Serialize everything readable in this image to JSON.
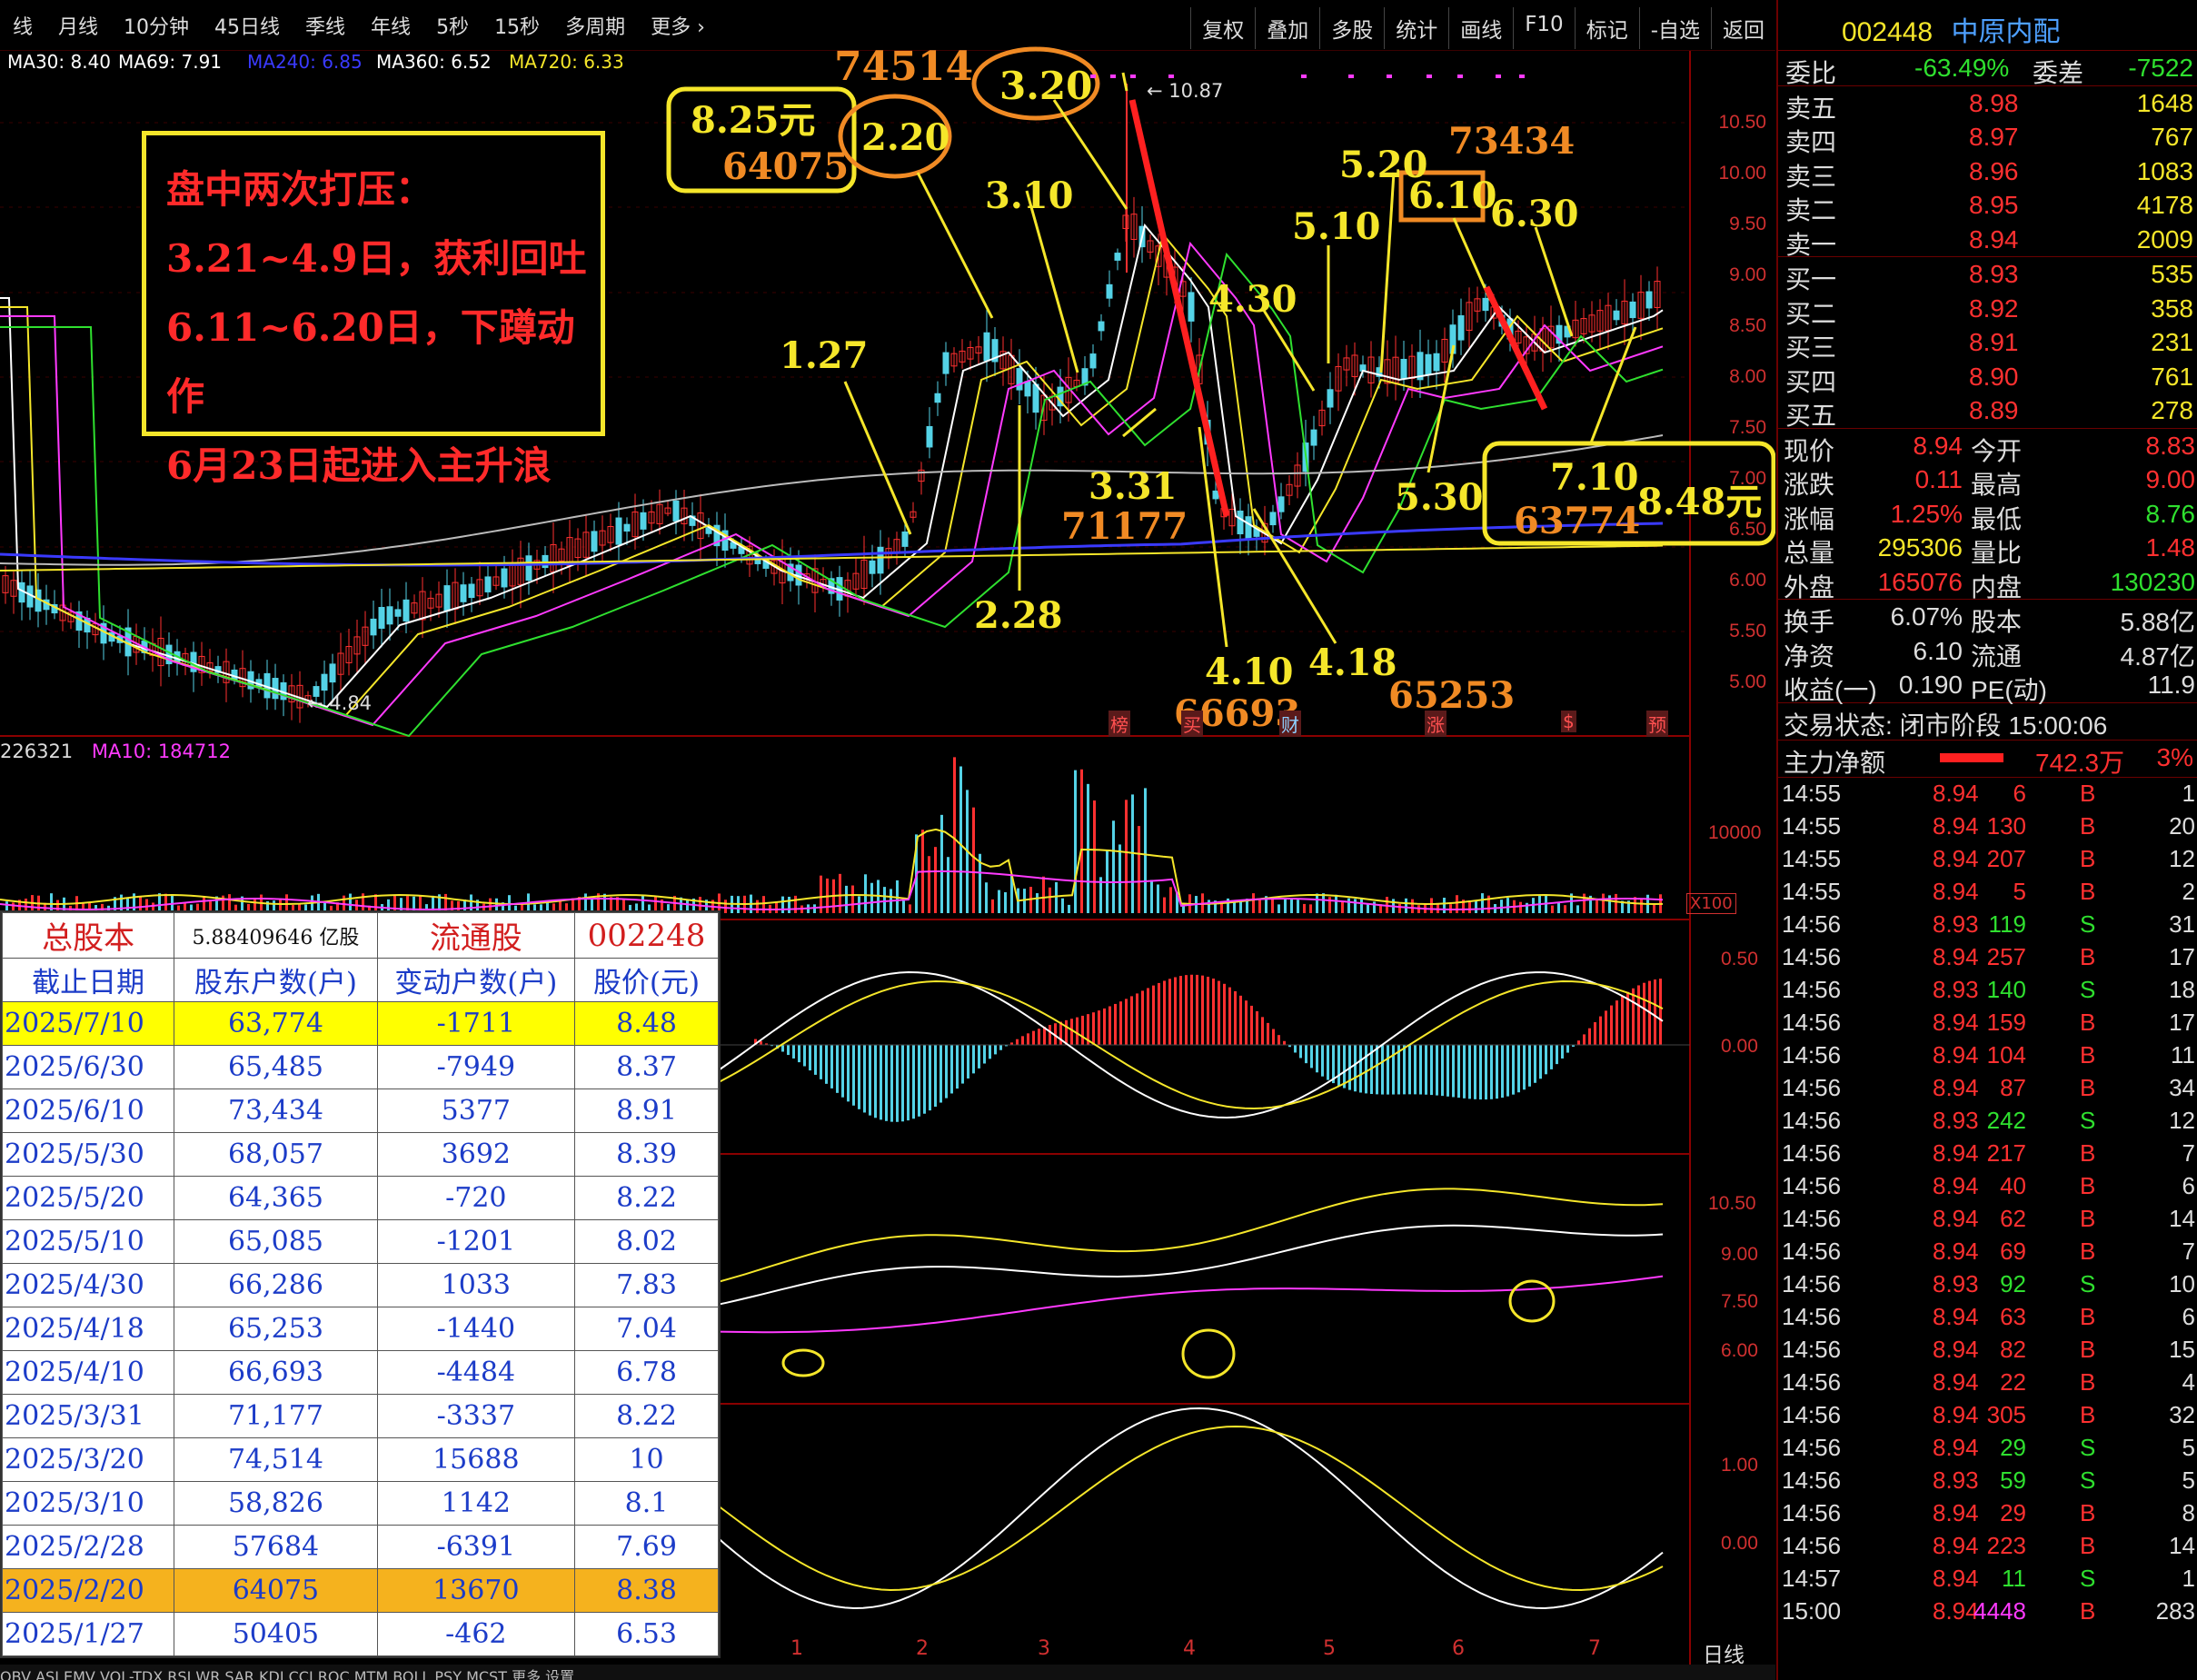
{
  "period_tabs": [
    "线",
    "月线",
    "10分钟",
    "45日线",
    "季线",
    "年线",
    "5秒",
    "15秒",
    "多周期",
    "更多 ›"
  ],
  "tool_tabs": [
    "复权",
    "叠加",
    "多股",
    "统计",
    "画线",
    "F10",
    "标记",
    "-自选",
    "返回"
  ],
  "ma_legend": [
    {
      "text": "MA30: 8.40",
      "color": "#ffffff"
    },
    {
      "text": "MA69: 7.91",
      "color": "#ffffff"
    },
    {
      "text": "MA240: 6.85",
      "color": "#3a3aff"
    },
    {
      "text": "MA360: 6.52",
      "color": "#ffffff"
    },
    {
      "text": "MA720: 6.33",
      "color": "#f5e62a"
    }
  ],
  "price_axis": [
    "10.50",
    "10.00",
    "9.50",
    "9.00",
    "8.50",
    "8.00",
    "7.50",
    "7.00",
    "6.50",
    "6.00",
    "5.50",
    "5.00"
  ],
  "hi_label": "10.87",
  "lo_label": "4.84",
  "note": [
    "盘中两次打压：",
    "3.21~4.9日，获利回吐",
    "6.11~6.20日，下蹲动作",
    "6月23日起进入主升浪"
  ],
  "callouts": {
    "c1": "74514",
    "c2": "8.25元",
    "c3": "64075",
    "c4": "2.20",
    "c5": "3.20",
    "c6": "3.10",
    "c7": "1.27",
    "c8": "3.31",
    "c9": "71177",
    "c10": "2.28",
    "c11": "4.10",
    "c12": "66693",
    "c13": "4.18",
    "c14": "65253",
    "c15": "4.30",
    "c16": "5.10",
    "c17": "5.20",
    "c18": "73434",
    "c19": "6.10",
    "c20": "6.30",
    "c21": "5.30",
    "c22": "7.10",
    "c23": "63774",
    "c24": "8.48元"
  },
  "markers": [
    "榜",
    "买",
    "财",
    "涨",
    "$",
    "预"
  ],
  "vol_legend": {
    "vol": "226321",
    "ma10": "MA10: 184712"
  },
  "vol_axis": {
    "top": "10000",
    "unit": "X100"
  },
  "macd_axis": [
    "0.50",
    "0.00"
  ],
  "band_axis": [
    "10.50",
    "9.00",
    "7.50",
    "6.00"
  ],
  "kdj_axis": [
    "1.00",
    "0.00"
  ],
  "month_labels": [
    "1",
    "2",
    "3",
    "4",
    "5",
    "6",
    "7"
  ],
  "day_line": "日线",
  "bottom_tabs": "OBV ASI EMV VOL-TDX RSI WR SAR KDJ CCI ROC MTM BOLL PSY MCST 更多 设置",
  "holders": {
    "title_cells": [
      "总股本",
      "5.88409646 亿股",
      "流通股",
      "002248"
    ],
    "columns": [
      "截止日期",
      "股东户数(户)",
      "变动户数(户)",
      "股价(元)"
    ],
    "rows": [
      {
        "date": "2025/7/10",
        "holders": "63,774",
        "change": "-1711",
        "price": "8.48",
        "hl": "yellow"
      },
      {
        "date": "2025/6/30",
        "holders": "65,485",
        "change": "-7949",
        "price": "8.37",
        "hl": ""
      },
      {
        "date": "2025/6/10",
        "holders": "73,434",
        "change": "5377",
        "price": "8.91",
        "hl": ""
      },
      {
        "date": "2025/5/30",
        "holders": "68,057",
        "change": "3692",
        "price": "8.39",
        "hl": ""
      },
      {
        "date": "2025/5/20",
        "holders": "64,365",
        "change": "-720",
        "price": "8.22",
        "hl": ""
      },
      {
        "date": "2025/5/10",
        "holders": "65,085",
        "change": "-1201",
        "price": "8.02",
        "hl": ""
      },
      {
        "date": "2025/4/30",
        "holders": "66,286",
        "change": "1033",
        "price": "7.83",
        "hl": ""
      },
      {
        "date": "2025/4/18",
        "holders": "65,253",
        "change": "-1440",
        "price": "7.04",
        "hl": ""
      },
      {
        "date": "2025/4/10",
        "holders": "66,693",
        "change": "-4484",
        "price": "6.78",
        "hl": ""
      },
      {
        "date": "2025/3/31",
        "holders": "71,177",
        "change": "-3337",
        "price": "8.22",
        "hl": ""
      },
      {
        "date": "2025/3/20",
        "holders": "74,514",
        "change": "15688",
        "price": "10",
        "hl": ""
      },
      {
        "date": "2025/3/10",
        "holders": "58,826",
        "change": "1142",
        "price": "8.1",
        "hl": ""
      },
      {
        "date": "2025/2/28",
        "holders": "57684",
        "change": "-6391",
        "price": "7.69",
        "hl": ""
      },
      {
        "date": "2025/2/20",
        "holders": "64075",
        "change": "13670",
        "price": "8.38",
        "hl": "orange"
      },
      {
        "date": "2025/1/27",
        "holders": "50405",
        "change": "-462",
        "price": "6.53",
        "hl": ""
      }
    ]
  },
  "stock": {
    "code": "002448",
    "name": "中原内配"
  },
  "order_ratio": {
    "l1": "委比",
    "v1": "-63.49%",
    "l2": "委差",
    "v2": "-7522"
  },
  "asks": [
    {
      "label": "卖五",
      "price": "8.98",
      "vol": "1648"
    },
    {
      "label": "卖四",
      "price": "8.97",
      "vol": "767"
    },
    {
      "label": "卖三",
      "price": "8.96",
      "vol": "1083"
    },
    {
      "label": "卖二",
      "price": "8.95",
      "vol": "4178"
    },
    {
      "label": "卖一",
      "price": "8.94",
      "vol": "2009"
    }
  ],
  "bids": [
    {
      "label": "买一",
      "price": "8.93",
      "vol": "535"
    },
    {
      "label": "买二",
      "price": "8.92",
      "vol": "358"
    },
    {
      "label": "买三",
      "price": "8.91",
      "vol": "231"
    },
    {
      "label": "买四",
      "price": "8.90",
      "vol": "761"
    },
    {
      "label": "买五",
      "price": "8.89",
      "vol": "278"
    }
  ],
  "quote": [
    {
      "l1": "现价",
      "v1": "8.94",
      "l2": "今开",
      "v2": "8.83"
    },
    {
      "l1": "涨跌",
      "v1": "0.11",
      "l2": "最高",
      "v2": "9.00"
    },
    {
      "l1": "涨幅",
      "v1": "1.25%",
      "l2": "最低",
      "v2": "8.76"
    },
    {
      "l1": "总量",
      "v1": "295306",
      "l2": "量比",
      "v2": "1.48"
    },
    {
      "l1": "外盘",
      "v1": "165076",
      "l2": "内盘",
      "v2": "130230"
    }
  ],
  "fundamentals": [
    {
      "l1": "换手",
      "v1": "6.07%",
      "l2": "股本",
      "v2": "5.88亿"
    },
    {
      "l1": "净资",
      "v1": "6.10",
      "l2": "流通",
      "v2": "4.87亿"
    },
    {
      "l1": "收益(一)",
      "v1": "0.190",
      "l2": "PE(动)",
      "v2": "11.9"
    }
  ],
  "trade_status": "交易状态: 闭市阶段 15:00:06",
  "main_flow": {
    "label": "主力净额",
    "value": "742.3万",
    "pct": "3%"
  },
  "ticks": [
    {
      "t": "14:55",
      "p": "8.94",
      "v": "6",
      "s": "B",
      "n": "1"
    },
    {
      "t": "14:55",
      "p": "8.94",
      "v": "130",
      "s": "B",
      "n": "20"
    },
    {
      "t": "14:55",
      "p": "8.94",
      "v": "207",
      "s": "B",
      "n": "12"
    },
    {
      "t": "14:55",
      "p": "8.94",
      "v": "5",
      "s": "B",
      "n": "2"
    },
    {
      "t": "14:56",
      "p": "8.93",
      "v": "119",
      "s": "S",
      "n": "31"
    },
    {
      "t": "14:56",
      "p": "8.94",
      "v": "257",
      "s": "B",
      "n": "17"
    },
    {
      "t": "14:56",
      "p": "8.93",
      "v": "140",
      "s": "S",
      "n": "18"
    },
    {
      "t": "14:56",
      "p": "8.94",
      "v": "159",
      "s": "B",
      "n": "17"
    },
    {
      "t": "14:56",
      "p": "8.94",
      "v": "104",
      "s": "B",
      "n": "11"
    },
    {
      "t": "14:56",
      "p": "8.94",
      "v": "87",
      "s": "B",
      "n": "34"
    },
    {
      "t": "14:56",
      "p": "8.93",
      "v": "242",
      "s": "S",
      "n": "12"
    },
    {
      "t": "14:56",
      "p": "8.94",
      "v": "217",
      "s": "B",
      "n": "7"
    },
    {
      "t": "14:56",
      "p": "8.94",
      "v": "40",
      "s": "B",
      "n": "6"
    },
    {
      "t": "14:56",
      "p": "8.94",
      "v": "62",
      "s": "B",
      "n": "14"
    },
    {
      "t": "14:56",
      "p": "8.94",
      "v": "69",
      "s": "B",
      "n": "7"
    },
    {
      "t": "14:56",
      "p": "8.93",
      "v": "92",
      "s": "S",
      "n": "10"
    },
    {
      "t": "14:56",
      "p": "8.94",
      "v": "63",
      "s": "B",
      "n": "6"
    },
    {
      "t": "14:56",
      "p": "8.94",
      "v": "82",
      "s": "B",
      "n": "15"
    },
    {
      "t": "14:56",
      "p": "8.94",
      "v": "22",
      "s": "B",
      "n": "4"
    },
    {
      "t": "14:56",
      "p": "8.94",
      "v": "305",
      "s": "B",
      "n": "32"
    },
    {
      "t": "14:56",
      "p": "8.94",
      "v": "29",
      "s": "S",
      "n": "5"
    },
    {
      "t": "14:56",
      "p": "8.93",
      "v": "59",
      "s": "S",
      "n": "5"
    },
    {
      "t": "14:56",
      "p": "8.94",
      "v": "29",
      "s": "B",
      "n": "8"
    },
    {
      "t": "14:56",
      "p": "8.94",
      "v": "223",
      "s": "B",
      "n": "14"
    },
    {
      "t": "14:57",
      "p": "8.94",
      "v": "11",
      "s": "S",
      "n": "1"
    },
    {
      "t": "15:00",
      "p": "8.94",
      "v": "4448",
      "s": "B",
      "n": "283"
    }
  ]
}
